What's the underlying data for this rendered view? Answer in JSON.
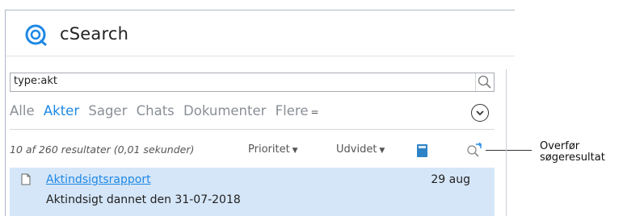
{
  "app": {
    "title": "cSearch"
  },
  "search": {
    "query": "type:akt"
  },
  "tabs": [
    {
      "label": "Alle",
      "active": false
    },
    {
      "label": "Akter",
      "active": true
    },
    {
      "label": "Sager",
      "active": false
    },
    {
      "label": "Chats",
      "active": false
    },
    {
      "label": "Dokumenter",
      "active": false
    },
    {
      "label": "Flere",
      "active": false,
      "caret": "="
    }
  ],
  "results_bar": {
    "summary": "10 af 260 resultater (0,01 sekunder)",
    "sort_label": "Prioritet",
    "view_label": "Udvidet"
  },
  "callout": {
    "line1": "Overfør",
    "line2": "søgeresultat"
  },
  "results": [
    {
      "title": "Aktindsigtsrapport",
      "date": "29 aug",
      "subtitle": "Aktindsigt dannet den 31-07-2018"
    }
  ],
  "colors": {
    "accent": "#1e88e5",
    "selected_row": "#d5e6f8",
    "book_icon": "#2d83c6"
  }
}
